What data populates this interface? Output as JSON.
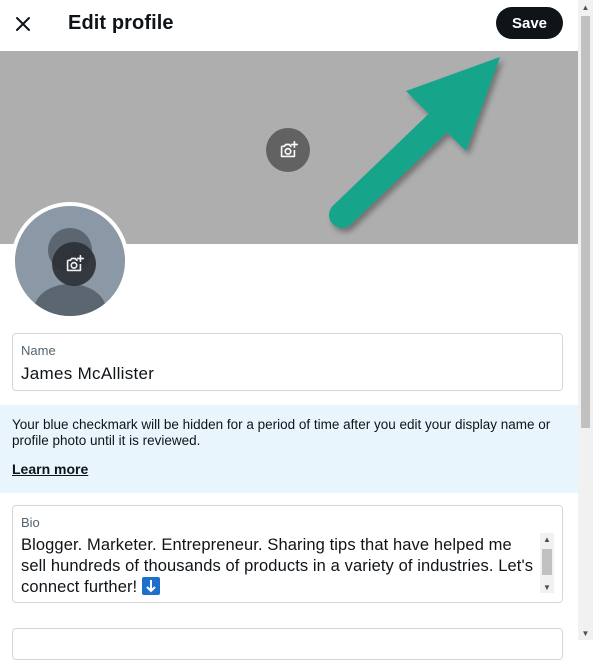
{
  "header": {
    "close_icon": "close-icon",
    "title": "Edit profile",
    "save_label": "Save"
  },
  "banner": {
    "camera_icon": "add-photo-icon",
    "annotation": "arrow pointing to Save"
  },
  "avatar": {
    "camera_icon": "add-photo-icon"
  },
  "name_field": {
    "label": "Name",
    "value": "James McAllister"
  },
  "notice": {
    "text": "Your blue checkmark will be hidden for a period of time after you edit your display name or profile photo until it is reviewed.",
    "link": "Learn more"
  },
  "bio_field": {
    "label": "Bio",
    "value": "Blogger. Marketer. Entrepreneur. Sharing tips that have helped me sell hundreds of thousands of products in a variety of industries. Let's connect further!"
  },
  "colors": {
    "save_bg": "#0f1419",
    "banner_bg": "#aeaeae",
    "notice_bg": "#e8f5fd",
    "arrow": "#12a58b"
  }
}
